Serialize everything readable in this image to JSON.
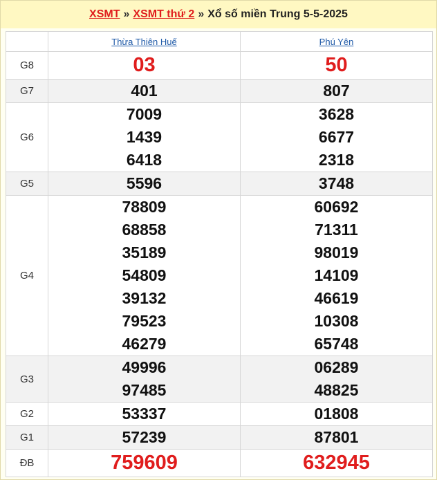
{
  "breadcrumb": {
    "link1": "XSMT",
    "sep1": "»",
    "link2": "XSMT thứ 2",
    "sep2": "»",
    "text": "Xổ số miền Trung 5-5-2025"
  },
  "provinces": [
    "Thừa Thiên Huế",
    "Phú Yên"
  ],
  "prizes": [
    {
      "label": "G8",
      "highlight": true,
      "values": [
        [
          "03"
        ],
        [
          "50"
        ]
      ]
    },
    {
      "label": "G7",
      "values": [
        [
          "401"
        ],
        [
          "807"
        ]
      ]
    },
    {
      "label": "G6",
      "values": [
        [
          "7009",
          "1439",
          "6418"
        ],
        [
          "3628",
          "6677",
          "2318"
        ]
      ]
    },
    {
      "label": "G5",
      "values": [
        [
          "5596"
        ],
        [
          "3748"
        ]
      ]
    },
    {
      "label": "G4",
      "values": [
        [
          "78809",
          "68858",
          "35189",
          "54809",
          "39132",
          "79523",
          "46279"
        ],
        [
          "60692",
          "71311",
          "98019",
          "14109",
          "46619",
          "10308",
          "65748"
        ]
      ]
    },
    {
      "label": "G3",
      "values": [
        [
          "49996",
          "97485"
        ],
        [
          "06289",
          "48825"
        ]
      ]
    },
    {
      "label": "G2",
      "values": [
        [
          "53337"
        ],
        [
          "01808"
        ]
      ]
    },
    {
      "label": "G1",
      "values": [
        [
          "57239"
        ],
        [
          "87801"
        ]
      ]
    },
    {
      "label": "ĐB",
      "highlight": true,
      "values": [
        [
          "759609"
        ],
        [
          "632945"
        ]
      ]
    }
  ]
}
